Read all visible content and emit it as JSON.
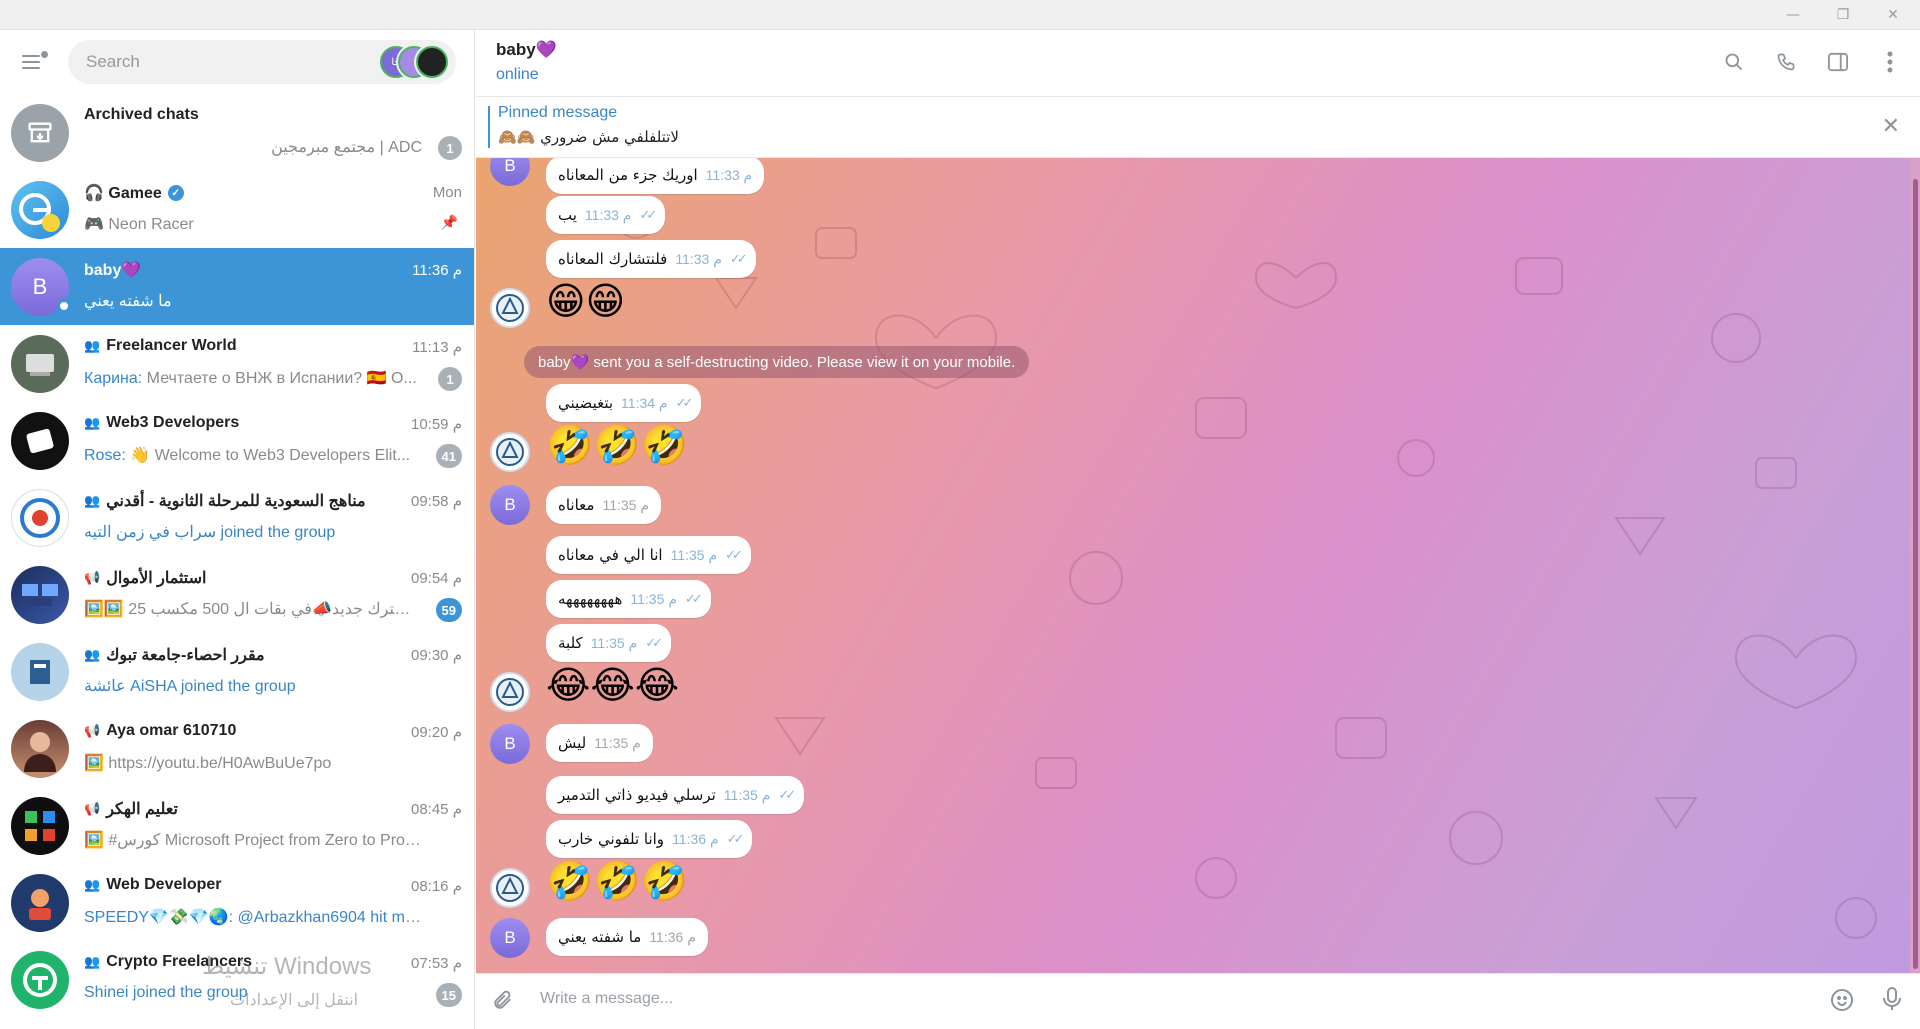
{
  "window": {
    "minimize": "—",
    "maximize": "❐",
    "close": "✕"
  },
  "search": {
    "placeholder": "Search"
  },
  "stories": [
    "خا",
    "",
    ""
  ],
  "chats": [
    {
      "name": "Archived chats",
      "preview": "ADC | مجتمع مبرمجين",
      "badge": "1"
    },
    {
      "name": "🎧 Gamee",
      "time": "Mon",
      "preview": "🎮 Neon Racer"
    },
    {
      "name": "baby💜",
      "time": "11:36 م",
      "preview": "ما شفته يعني",
      "avatar": "B"
    },
    {
      "name": "Freelancer World",
      "time": "11:13 م",
      "sender": "Карина:",
      "preview": " Мечтаете о ВНЖ в Испании? 🇪🇸 О...",
      "badge": "1"
    },
    {
      "name": "Web3 Developers",
      "time": "10:59 م",
      "sender": "Rose:",
      "preview": " 👋 Welcome to Web3 Developers Elit...",
      "badge": "41"
    },
    {
      "name": "مناهج السعودية للمرحلة الثانوية - أقدني",
      "time": "09:58 م",
      "preview": "سراب في زمن التيه joined the group"
    },
    {
      "name": "استثمار الأموال",
      "time": "09:54 م",
      "preview": "🖼️🖼️ مشترك جديد📣في بقات ال 500 مكسب 25...",
      "badge": "59"
    },
    {
      "name": "مقرر احصاء-جامعة تبوك",
      "time": "09:30 م",
      "preview": "عائشة AiSHA joined the group"
    },
    {
      "name": "Aya omar 610710",
      "time": "09:20 م",
      "preview": "🖼️ https://youtu.be/H0AwBuUe7po"
    },
    {
      "name": "تعليم الهكر",
      "time": "08:45 م",
      "preview": "🖼️ #كورس Microsoft Project from Zero to Pro ..."
    },
    {
      "name": "Web Developer",
      "time": "08:16 م",
      "preview": "SPEEDY💎💸💎🌏: @Arbazkhan6904 hit me u..."
    },
    {
      "name": "Crypto Freelancers",
      "time": "07:53 م",
      "preview": "Shinei joined the group",
      "badge": "15"
    }
  ],
  "watermark": {
    "line1": "تنشيط Windows",
    "line2": "انتقل إلى الإعدادات"
  },
  "header": {
    "name": "baby💜",
    "status": "online"
  },
  "pinned": {
    "title": "Pinned message",
    "text": "لاتتلفلفي مش ضروري 🙈🙈"
  },
  "messages": [
    {
      "text": "اوريك جزء من المعاناه",
      "time": "11:33 م",
      "out": true
    },
    {
      "text": "يب",
      "time": "11:33 م",
      "out": true
    },
    {
      "text": "فلنتشارك المعاناه",
      "time": "11:33 م",
      "out": true
    },
    {
      "emoji": "😁😁"
    },
    {
      "service": "baby💜 sent you a self-destructing video. Please view it on your mobile."
    },
    {
      "text": "بتغيضيني",
      "time": "11:34 م",
      "out": true
    },
    {
      "emoji": "🤣🤣🤣"
    },
    {
      "text": "معاناه",
      "time": "11:35 م"
    },
    {
      "text": "انا الي في معاناه",
      "time": "11:35 م",
      "out": true
    },
    {
      "text": "ههههههههه",
      "time": "11:35 م",
      "out": true
    },
    {
      "text": "كلبة",
      "time": "11:35 م",
      "out": true
    },
    {
      "emoji": "😂😂😂"
    },
    {
      "text": "ليش",
      "time": "11:35 م"
    },
    {
      "text": "ترسلي فيديو ذاتي التدمير",
      "time": "11:35 م",
      "out": true
    },
    {
      "text": "وانا تلفوني خارب",
      "time": "11:36 م",
      "out": true
    },
    {
      "emoji": "🤣🤣🤣"
    },
    {
      "text": "ما شفته يعني",
      "time": "11:36 م"
    }
  ],
  "composer": {
    "placeholder": "Write a message..."
  },
  "colors": {
    "accent": "#3d95d8",
    "active_row": "#3d95d8"
  }
}
